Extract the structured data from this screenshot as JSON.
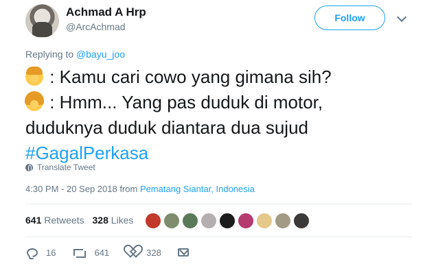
{
  "author": {
    "name": "Achmad A Hrp",
    "handle": "@ArcAchmad"
  },
  "header": {
    "follow_label": "Follow"
  },
  "reply": {
    "prefix": "Replying to ",
    "mention": "@bayu_joo"
  },
  "tweet": {
    "line1": ": Kamu cari cowo yang gimana sih?",
    "line2": ": Hmm... Yang pas duduk di motor,",
    "line3": "duduknya duduk diantara dua sujud",
    "hashtag": "#GagalPerkasa",
    "emoji1": "boy-emoji",
    "emoji2": "girl-emoji"
  },
  "translate_label": "Translate Tweet",
  "timestamp": {
    "time": "4:30 PM - 20 Sep 2018 from ",
    "place": "Pematang Siantar, Indonesia"
  },
  "stats": {
    "retweets_count": "641",
    "retweets_label": " Retweets",
    "likes_count": "328",
    "likes_label": " Likes"
  },
  "likers": [
    "#c0392b",
    "#7f8c6d",
    "#5b7a5a",
    "#b5aeb0",
    "#1c1c1c",
    "#b43a6f",
    "#e5c98b",
    "#a39a86",
    "#3c3a38"
  ],
  "actions": {
    "replies": "16",
    "retweets": "641",
    "likes": "328"
  },
  "colors": {
    "accent": "#1da1f2",
    "muted": "#657786"
  }
}
